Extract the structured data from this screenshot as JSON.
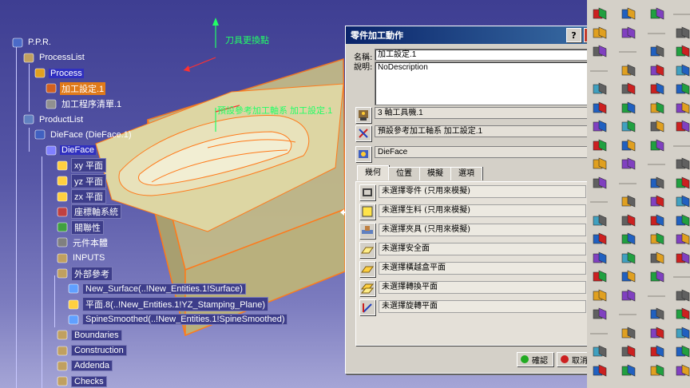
{
  "tree": {
    "items": [
      {
        "label": "P.P.R.",
        "icon": "ppr-icon",
        "level": 0,
        "style": "plain"
      },
      {
        "label": "ProcessList",
        "icon": "process-list-icon",
        "level": 1,
        "style": "plain"
      },
      {
        "label": "Process",
        "icon": "process-icon",
        "level": 2,
        "style": "selected"
      },
      {
        "label": "加工設定.1",
        "icon": "machining-setup-icon",
        "level": 3,
        "style": "orange"
      },
      {
        "label": "加工程序清單.1",
        "icon": "program-list-icon",
        "level": 3,
        "style": "plain"
      },
      {
        "label": "ProductList",
        "icon": "product-list-icon",
        "level": 1,
        "style": "plain"
      },
      {
        "label": "DieFace (DieFace.1)",
        "icon": "product-icon",
        "level": 2,
        "style": "plain"
      },
      {
        "label": "DieFace",
        "icon": "part-icon",
        "level": 3,
        "style": "selected"
      },
      {
        "label": "xy 平面",
        "icon": "plane-icon",
        "level": 4,
        "style": "boxed"
      },
      {
        "label": "yz 平面",
        "icon": "plane-icon",
        "level": 4,
        "style": "boxed"
      },
      {
        "label": "zx 平面",
        "icon": "plane-icon",
        "level": 4,
        "style": "boxed"
      },
      {
        "label": "座標軸系統",
        "icon": "axis-system-icon",
        "level": 4,
        "style": "boxed"
      },
      {
        "label": "關聯性",
        "icon": "relations-icon",
        "level": 4,
        "style": "boxed"
      },
      {
        "label": "元件本體",
        "icon": "part-body-icon",
        "level": 4,
        "style": "plain"
      },
      {
        "label": "INPUTS",
        "icon": "inputs-icon",
        "level": 4,
        "style": "plain"
      },
      {
        "label": "外部參考",
        "icon": "external-reference-icon",
        "level": 4,
        "style": "boxed"
      },
      {
        "label": "New_Surface(..!New_Entities.1!Surface)",
        "icon": "surface-icon",
        "level": 5,
        "style": "boxed"
      },
      {
        "label": "平面.8(..!New_Entities.1!YZ_Stamping_Plane)",
        "icon": "plane-ref-icon",
        "level": 5,
        "style": "boxed"
      },
      {
        "label": "SpineSmoothed(..!New_Entities.1!SpineSmoothed)",
        "icon": "spine-icon",
        "level": 5,
        "style": "boxed"
      },
      {
        "label": "Boundaries",
        "icon": "geometric-set-icon",
        "level": 4,
        "style": "boxed"
      },
      {
        "label": "Construction",
        "icon": "geometric-set-icon",
        "level": 4,
        "style": "boxed"
      },
      {
        "label": "Addenda",
        "icon": "geometric-set-icon",
        "level": 4,
        "style": "boxed"
      },
      {
        "label": "Checks",
        "icon": "geometric-set-icon",
        "level": 4,
        "style": "boxed"
      }
    ]
  },
  "viewport": {
    "annotation_tool_change": "刀具更換點",
    "annotation_axis": "預設參考加工軸系 加工設定.1"
  },
  "dialog": {
    "title": "零件加工動作",
    "help_label": "?",
    "close_label": "✕",
    "name_label": "名稱:",
    "desc_label": "說明:",
    "name_value": "加工設定.1",
    "desc_value": "NoDescription",
    "machine_value": "3 軸工具機.1",
    "axis_value": "預設參考加工軸系 加工設定.1",
    "product_value": "DieFace",
    "tabs": [
      "幾何",
      "位置",
      "模擬",
      "選項"
    ],
    "active_tab": 0,
    "geometry_rows": [
      {
        "text": "未選擇零件 (只用來模擬)",
        "icon": "design-part-icon"
      },
      {
        "text": "未選擇生料 (只用來模擬)",
        "icon": "stock-icon"
      },
      {
        "text": "未選擇夾具 (只用來模擬)",
        "icon": "fixture-icon"
      },
      {
        "text": "未選擇安全面",
        "icon": "safety-plane-icon"
      },
      {
        "text": "未選擇橫越盒平面",
        "icon": "traverse-box-icon"
      },
      {
        "text": "未選擇轉換平面",
        "icon": "transition-plane-icon"
      },
      {
        "text": "未選擇旋轉平面",
        "icon": "rotary-plane-icon"
      }
    ],
    "ok_label": "確認",
    "cancel_label": "取消"
  },
  "colors": {
    "viewport_top": "#3e3e92",
    "viewport_bottom": "#a5a5d6",
    "dialog_title": "#0a246a",
    "wireframe": "#ff7a1a",
    "tree_selected": "#3030c0",
    "annotation": "#22ff66"
  }
}
